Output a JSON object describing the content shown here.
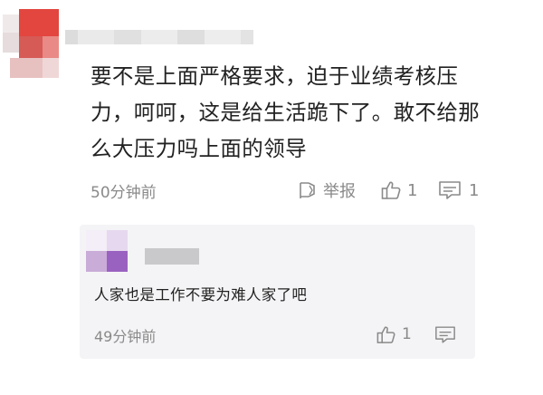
{
  "main_comment": {
    "text_lines": [
      "要不是上面严格要求，迫于业绩考核压",
      "力，呵呵，这是给生活跪下了。敢不给那",
      "么大压力吗上面的领导"
    ],
    "timestamp": "50分钟前",
    "report_label": "举报",
    "like_count": "1",
    "comment_count": "1"
  },
  "reply": {
    "text": "人家也是工作不要为难人家了吧",
    "timestamp": "49分钟前",
    "like_count": "1"
  },
  "colors": {
    "meta_gray": "#8a8a8a",
    "reply_bg": "#f4f4f6",
    "avatar_red": "#e2463f",
    "avatar_purple": "#9a62c0"
  },
  "icons": {
    "report": "flag-icon",
    "like": "thumbs-up-icon",
    "comment": "comment-bubble-icon"
  }
}
